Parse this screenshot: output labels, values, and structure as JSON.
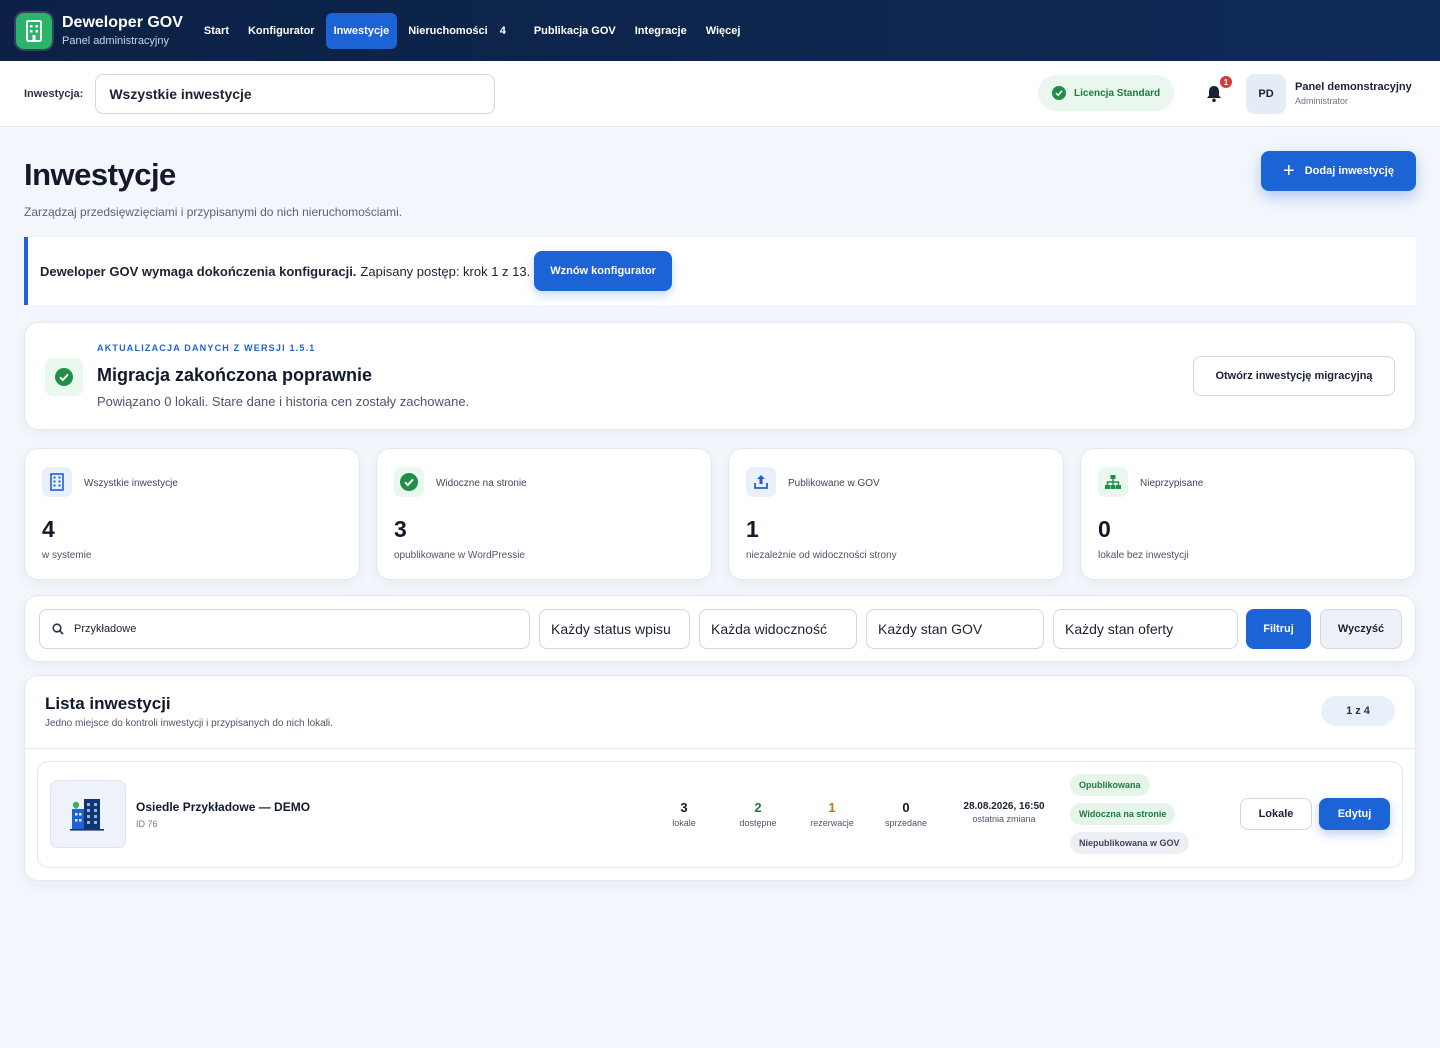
{
  "brand": {
    "title": "Deweloper GOV",
    "subtitle": "Panel administracyjny"
  },
  "nav": {
    "items": [
      {
        "label": "Start"
      },
      {
        "label": "Konfigurator"
      },
      {
        "label": "Inwestycje",
        "active": true
      },
      {
        "label": "Nieruchomości",
        "badge": "4"
      },
      {
        "label": "Publikacja GOV"
      },
      {
        "label": "Integracje"
      },
      {
        "label": "Więcej"
      }
    ]
  },
  "subheader": {
    "investment_label": "Inwestycja:",
    "investment_value": "Wszystkie inwestycje",
    "license": "Licencja Standard",
    "notifications_count": "1",
    "avatar_initials": "PD",
    "user_name": "Panel demonstracyjny",
    "user_role": "Administrator"
  },
  "page": {
    "title": "Inwestycje",
    "subtitle": "Zarządzaj przedsięwzięciami i przypisanymi do nich nieruchomościami.",
    "add_button": "Dodaj inwestycję"
  },
  "notice": {
    "bold": "Deweloper GOV wymaga dokończenia konfiguracji.",
    "text": "Zapisany postęp: krok 1 z 13.",
    "button": "Wznów konfigurator"
  },
  "migration": {
    "eyebrow": "AKTUALIZACJA DANYCH Z WERSJI 1.5.1",
    "title": "Migracja zakończona poprawnie",
    "description": "Powiązano 0 lokali. Stare dane i historia cen zostały zachowane.",
    "button": "Otwórz inwestycję migracyjną"
  },
  "stats": [
    {
      "label": "Wszystkie inwestycje",
      "value": "4",
      "note": "w systemie",
      "icon": "building-icon"
    },
    {
      "label": "Widoczne na stronie",
      "value": "3",
      "note": "opublikowane w WordPressie",
      "icon": "check-circle-icon"
    },
    {
      "label": "Publikowane w GOV",
      "value": "1",
      "note": "niezależnie od widoczności strony",
      "icon": "upload-icon"
    },
    {
      "label": "Nieprzypisane",
      "value": "0",
      "note": "lokale bez inwestycji",
      "icon": "hierarchy-icon"
    }
  ],
  "filters": {
    "search_value": "Przykładowe",
    "status": "Każdy status wpisu",
    "visibility": "Każda widoczność",
    "gov": "Każdy stan GOV",
    "offer": "Każdy stan oferty",
    "filter_button": "Filtruj",
    "clear_button": "Wyczyść"
  },
  "list": {
    "title": "Lista inwestycji",
    "subtitle": "Jedno miejsce do kontroli inwestycji i przypisanych do nich lokali.",
    "pager": "1 z 4",
    "rows": [
      {
        "name": "Osiedle Przykładowe — DEMO",
        "id": "ID 76",
        "metrics": [
          {
            "value": "3",
            "label": "lokale",
            "color": "#111a2b"
          },
          {
            "value": "2",
            "label": "dostępne",
            "color": "#1b7c3f"
          },
          {
            "value": "1",
            "label": "rezerwacje",
            "color": "#b7791f"
          },
          {
            "value": "0",
            "label": "sprzedane",
            "color": "#111a2b"
          }
        ],
        "last_change_value": "28.08.2026, 16:50",
        "last_change_label": "ostatnia zmiana",
        "badges": [
          "Opublikowana",
          "Widoczna na stronie",
          "Niepublikowana w GOV"
        ],
        "btn_local": "Lokale",
        "btn_edit": "Edytuj"
      }
    ]
  },
  "colors": {
    "accent": "#1c63d6",
    "nav_bg": "#0c2145",
    "success": "#1f8f46"
  }
}
